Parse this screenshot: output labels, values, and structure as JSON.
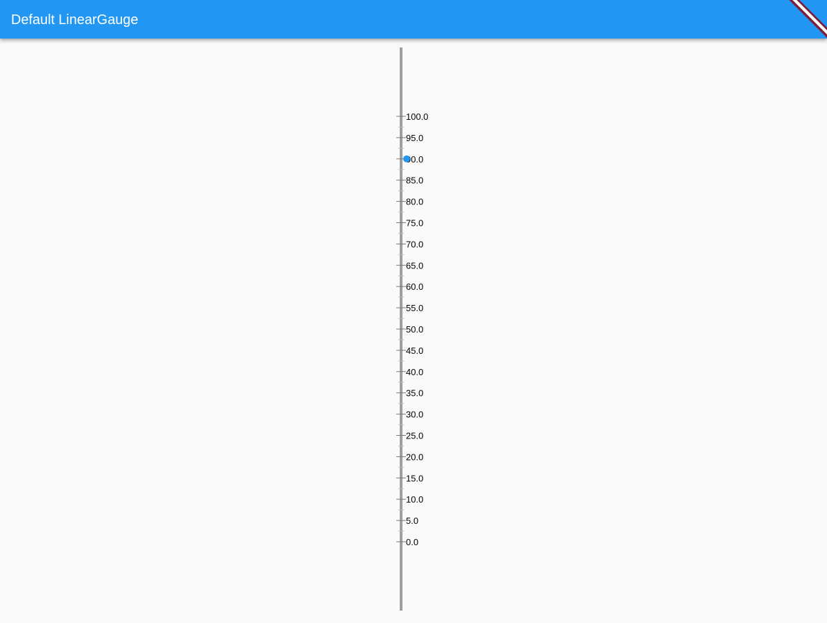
{
  "app_bar": {
    "title": "Default LinearGauge",
    "color": "#2196f3",
    "title_color": "#ffffff"
  },
  "debug_banner": {
    "stripe_color": "#7b1f3a"
  },
  "gauge": {
    "min": 0,
    "max": 100,
    "major_interval": 5,
    "minor_ticks_per_interval": 1,
    "label_decimals": 1,
    "pointer_value": 90,
    "axis_color": "#9e9e9e",
    "tick_color": "#757575",
    "label_color": "#000000",
    "pointer_color": "#2196f3"
  }
}
